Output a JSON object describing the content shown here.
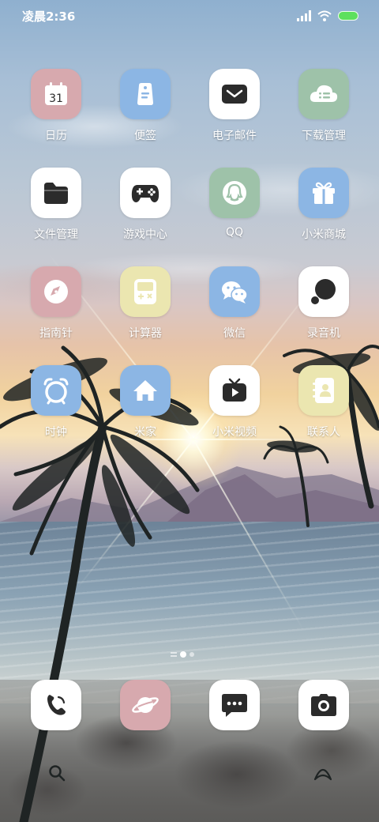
{
  "status_bar": {
    "time": "凌晨2:36",
    "battery_color": "#5de05d"
  },
  "apps": [
    {
      "label": "日历",
      "icon": "calendar-icon",
      "bg": "#d7a9ae",
      "date": "31"
    },
    {
      "label": "便签",
      "icon": "notes-icon",
      "bg": "#8cb6e4"
    },
    {
      "label": "电子邮件",
      "icon": "email-icon",
      "bg": "#ffffff"
    },
    {
      "label": "下载管理",
      "icon": "download-cloud-icon",
      "bg": "#9ec2a9"
    },
    {
      "label": "文件管理",
      "icon": "folder-icon",
      "bg": "#ffffff"
    },
    {
      "label": "游戏中心",
      "icon": "gamepad-icon",
      "bg": "#ffffff"
    },
    {
      "label": "QQ",
      "icon": "qq-penguin-icon",
      "bg": "#9ec2a9"
    },
    {
      "label": "小米商城",
      "icon": "gift-box-icon",
      "bg": "#8cb6e4"
    },
    {
      "label": "指南针",
      "icon": "compass-icon",
      "bg": "#d7a9ae"
    },
    {
      "label": "计算器",
      "icon": "calculator-icon",
      "bg": "#ebe6b0"
    },
    {
      "label": "微信",
      "icon": "wechat-icon",
      "bg": "#8cb6e4"
    },
    {
      "label": "录音机",
      "icon": "recorder-icon",
      "bg": "#ffffff"
    },
    {
      "label": "时钟",
      "icon": "alarm-clock-icon",
      "bg": "#8cb6e4"
    },
    {
      "label": "米家",
      "icon": "home-icon",
      "bg": "#8cb6e4"
    },
    {
      "label": "小米视频",
      "icon": "tv-play-icon",
      "bg": "#ffffff"
    },
    {
      "label": "联系人",
      "icon": "contacts-book-icon",
      "bg": "#ebe6b0"
    }
  ],
  "dock": [
    {
      "icon": "phone-icon",
      "bg": "#ffffff"
    },
    {
      "icon": "browser-planet-icon",
      "bg": "#d7a9ae"
    },
    {
      "icon": "messages-icon",
      "bg": "#ffffff"
    },
    {
      "icon": "camera-icon",
      "bg": "#ffffff"
    }
  ],
  "bottom_bar": {
    "left_icon": "search-icon",
    "right_icon": "ai-assistant-icon"
  },
  "pager": {
    "pages": 2,
    "active": 1
  }
}
